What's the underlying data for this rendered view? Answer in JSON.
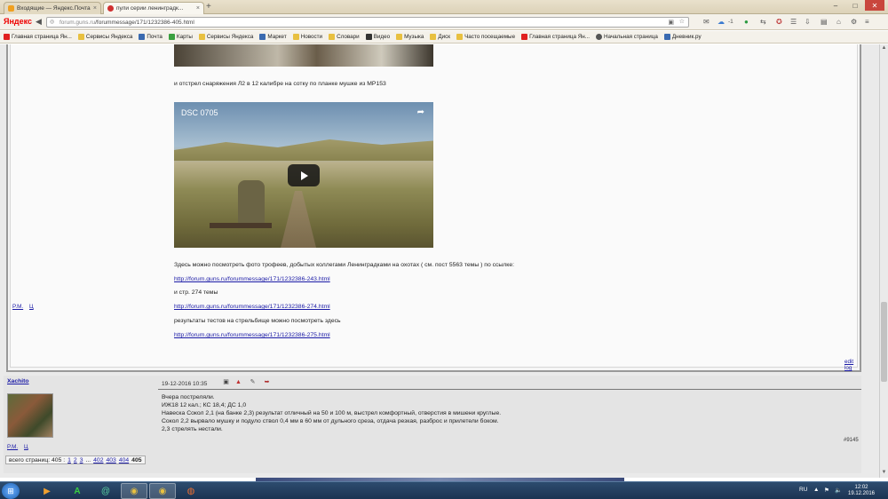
{
  "browser": {
    "tabs": [
      {
        "label": "Входящие — Яндекс.Почта",
        "active": false
      },
      {
        "label": "пули серии ленинградк...",
        "active": true
      }
    ],
    "new_tab": "+",
    "url_host": "forum.guns.ru",
    "url_path": "/forummessage/171/1232386-405.html",
    "logo": "Яндекс",
    "badge_count": "-1",
    "window_controls": [
      "–",
      "□",
      "✕"
    ]
  },
  "bookmarks": [
    {
      "label": "Главная страница Ян...",
      "icon_color": "#e02020"
    },
    {
      "label": "Сервисы Яндекса",
      "icon_color": "#e8c040"
    },
    {
      "label": "Почта",
      "icon_color": "#3a6ab0"
    },
    {
      "label": "Карты",
      "icon_color": "#3aa040"
    },
    {
      "label": "Сервисы Яндекса",
      "icon_color": "#e8c040"
    },
    {
      "label": "Маркет",
      "icon_color": "#3a6ab0"
    },
    {
      "label": "Новости",
      "icon_color": "#e8c040"
    },
    {
      "label": "Словари",
      "icon_color": "#e8c040"
    },
    {
      "label": "Видео",
      "icon_color": "#333333"
    },
    {
      "label": "Музыка",
      "icon_color": "#e8c040"
    },
    {
      "label": "Диск",
      "icon_color": "#e8c040"
    },
    {
      "label": "Часто посещаемые",
      "icon_color": "#e8c040"
    },
    {
      "label": "Главная страница Ян...",
      "icon_color": "#e02020"
    },
    {
      "label": "Начальная страница",
      "icon_color": "#555555"
    },
    {
      "label": "Дневник.ру",
      "icon_color": "#3a6ab0"
    }
  ],
  "post1": {
    "intro_text": "и отстрел снаряжения Л2 в 12 калибре на сотку по планке мушке из МР153",
    "video": {
      "title": "DSC 0705",
      "share_icon": "share-icon",
      "play_icon": "play-icon"
    },
    "text_trophies": "Здесь можно посмотреть фото трофеев, добытых коллегами Ленинградками на охотах ( см. пост 5563 темы ) по ссылке:",
    "link1": "http://forum.guns.ru/forummessage/171/1232386-243.html",
    "text_page": "и стр. 274 темы",
    "link2": "http://forum.guns.ru/forummessage/171/1232386-274.html",
    "text_results": "результаты тестов на стрельбище можно посмотреть здесь",
    "link3": "http://forum.guns.ru/forummessage/171/1232386-275.html",
    "pm": "P.M.",
    "ci": "Ц",
    "edit_log": "edit log"
  },
  "post2": {
    "author": "Xachito",
    "date": "19-12-2016 10:35",
    "lines": [
      "Вчера постреляли.",
      "ИЖ18 12 кал.; КС 18,4; ДС 1,0",
      "Навеска Сокол 2,1 (на банке 2,3) результат отличный на 50 и 100 м, выстрел комфортный, отверстия в мишени круглые.",
      "Сокол 2,2 вырвало мушку и подуло ствол 0,4 мм в 60 мм от дульного среза, отдача резкая, разброс и прилетели боком.",
      "2,3 стрелять нестали."
    ],
    "post_number": "#9145",
    "pm": "P.M.",
    "ci": "Ц"
  },
  "pager": {
    "label": "всего страниц: 405 :",
    "pages": [
      "1",
      "2",
      "3"
    ],
    "ellipsis": "...",
    "pages_end": [
      "402",
      "403",
      "404"
    ],
    "current": "405"
  },
  "taskbar": {
    "language": "RU",
    "time": "12:02",
    "date": "19.12.2016"
  }
}
